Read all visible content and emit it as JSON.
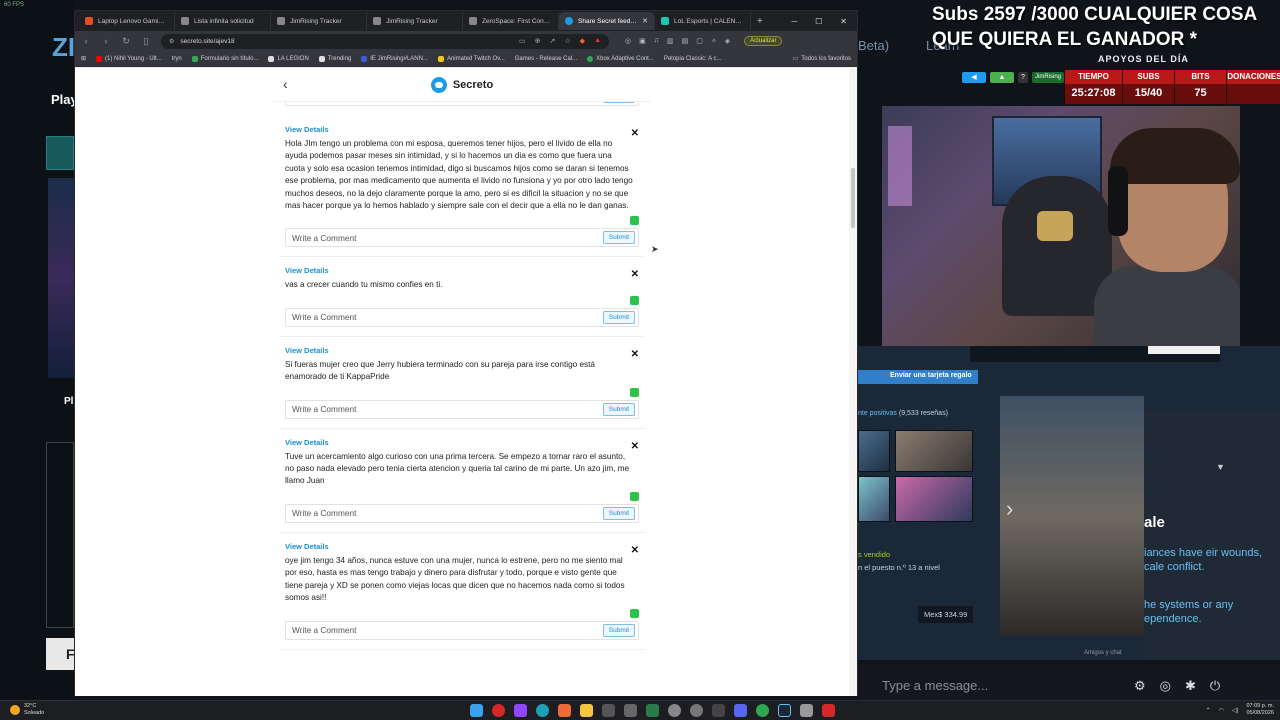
{
  "system": {
    "fps": "60 FPS"
  },
  "background_left": {
    "brand_partial": "ZI",
    "play_label": "Play",
    "pl_label": "Pl",
    "f_button": "F"
  },
  "browser": {
    "tabs": [
      {
        "label": "Laptop Lenovo Gaming Leg",
        "color": "#e34c26"
      },
      {
        "label": "Lista infinita solicitud",
        "color": "#888888"
      },
      {
        "label": "JimRising Tracker",
        "color": "#888888"
      },
      {
        "label": "JimRising Tracker",
        "color": "#888888"
      },
      {
        "label": "ZeroSpace: First Contact in",
        "color": "#888888"
      },
      {
        "label": "Share Secret feedback",
        "color": "#1e9be8",
        "active": true
      },
      {
        "label": "LoL Esports | CALENDARIO",
        "color": "#1ac6b4"
      }
    ],
    "url": "secreto.site/ajev18",
    "update_label": "Actualizar",
    "bookmarks": [
      {
        "label": "(1) Nihil Young - Ult...",
        "color": "#ff0000"
      },
      {
        "label": "tryn",
        "color": "#999999"
      },
      {
        "label": "Formulario sin título...",
        "color": "#34a853"
      },
      {
        "label": "LA LEGION",
        "color": "#dddddd"
      },
      {
        "label": "Trending",
        "color": "#dddddd"
      },
      {
        "label": "IE JimRising#LANN...",
        "color": "#3b5bdb"
      },
      {
        "label": "Animated Twitch Ov...",
        "color": "#f5c518"
      },
      {
        "label": "Games - Release Cal...",
        "color": "#999999"
      },
      {
        "label": "Xbox Adaptive Cont...",
        "color": "#2fa84f"
      },
      {
        "label": "Petopia Classic: A c...",
        "color": "#999999"
      }
    ],
    "bookmarks_all": "Todos los favoritos"
  },
  "page": {
    "brand": "Secreto",
    "comment_placeholder": "Write a Comment",
    "submit_label": "Submit",
    "view_details_label": "View Details",
    "posts": [
      {
        "text": "Hola JIm tengo un problema con mi esposa, queremos tener hijos, pero el livido de ella no ayuda podemos pasar meses sin intimidad, y si lo hacemos un dia es como que fuera una cuota y solo esa ocasion tenemos intimidad, digo si buscamos hijos como se daran si tenemos ese problema, por mas medicamento que aumenta el livido no funsiona y yo por otro lado tengo muchos deseos, no la dejo claramente porque la amo, pero si es dificil la situacion y no se que mas hacer porque ya lo hemos hablado y siempre sale con el decir que a ella no le dan ganas."
      },
      {
        "text": "vas a crecer cuando tu mismo confies en ti."
      },
      {
        "text": "Si fueras mujer creo que Jerry hubiera terminado con su pareja para irse contigo está enamorado de ti KappaPride"
      },
      {
        "text": "Tuve un acercamiento algo curioso con una prima tercera. Se empezo a tornar raro el asunto, no paso nada elevado pero tenia cierta atencion y queria tal carino de mi parte. Un azo jim, me llamo Juan"
      },
      {
        "text": "oye jim tengo 34 años, nunca estuve con una mujer, nunca lo estrene, pero no me siento mal por eso, hasta es mas tengo trabajo y dinero para disfrutar y todo, porque e visto gente que tiene pareja y XD se ponen como viejas locas que dicen que no hacemos nada como si todos somos asi!!"
      }
    ]
  },
  "stream_overlay": {
    "title": "Subs 2597 /3000 CUALQUIER COSA QUE QUIERA EL GANADOR *",
    "beta": "Beta)",
    "learn": "Learn",
    "apoyos": "APOYOS DEL DÍA",
    "channel": "JimRising",
    "stats": [
      {
        "key": "TIEMPO",
        "value": "25:27:08"
      },
      {
        "key": "SUBS",
        "value": "15/40"
      },
      {
        "key": "BITS",
        "value": "75"
      },
      {
        "key": "DONACIONES",
        "value": ""
      }
    ]
  },
  "steam": {
    "gift": "Enviar una tarjeta regalo",
    "reviews_label": "nte positivas",
    "reviews_count": "(9,533 reseñas)",
    "vendido": "s vendido",
    "puesto": "n el puesto n.º 13 a nivel",
    "price": "Mex$ 334.99",
    "side_heading": "ale",
    "side_text": "iances have eir wounds, cale conflict.",
    "side_text2": "he systems or any ependence.",
    "amigos": "Amigos y chat"
  },
  "chat": {
    "placeholder": "Type a message..."
  },
  "taskbar": {
    "temp": "32°C",
    "weather": "Soleado",
    "time": "07:09 p. m.",
    "date": "05/08/2026"
  }
}
